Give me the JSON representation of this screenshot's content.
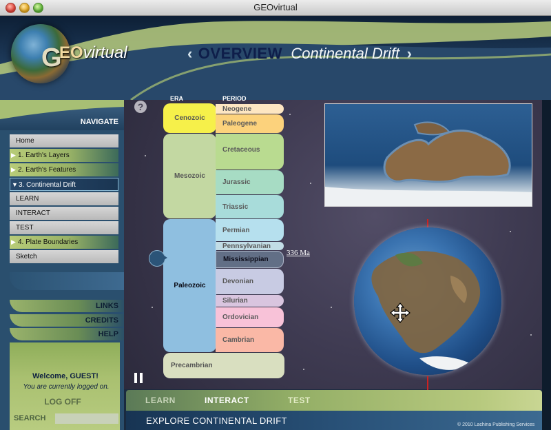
{
  "window": {
    "title": "GEOvirtual"
  },
  "logo": {
    "g": "G",
    "eo": "EO",
    "virtual": "virtual"
  },
  "header": {
    "overview": "OVERVIEW",
    "topic": "Continental Drift",
    "prev": "‹",
    "next": "›"
  },
  "navigate": {
    "label": "NAVIGATE"
  },
  "nav_items": [
    {
      "label": "Home",
      "style": "grey"
    },
    {
      "label": "1. Earth's Layers",
      "style": "green",
      "icon": "triangle-right-icon"
    },
    {
      "label": "2. Earth's Features",
      "style": "green",
      "icon": "triangle-right-icon"
    },
    {
      "label": "3. Continental Drift",
      "style": "active",
      "icon": "triangle-down-icon"
    },
    {
      "label": "LEARN",
      "style": "grey"
    },
    {
      "label": "INTERACT",
      "style": "grey"
    },
    {
      "label": "TEST",
      "style": "grey"
    },
    {
      "label": "4. Plate Boundaries",
      "style": "green",
      "icon": "triangle-right-icon"
    },
    {
      "label": "Sketch",
      "style": "grey"
    }
  ],
  "links": {
    "links": "LINKS",
    "credits": "CREDITS",
    "help": "HELP"
  },
  "user": {
    "welcome": "Welcome, GUEST!",
    "status": "You are currently logged on.",
    "logoff": "LOG OFF"
  },
  "search": {
    "label": "SEARCH",
    "value": "",
    "placeholder": ""
  },
  "timescale": {
    "era_heading": "ERA",
    "period_heading": "PERIOD",
    "eras": [
      {
        "name": "Cenozoic",
        "color": "#f6f04a"
      },
      {
        "name": "Mesozoic",
        "color": "#c3d8a2"
      },
      {
        "name": "Paleozoic",
        "color": "#8fbfe0"
      },
      {
        "name": "Precambrian",
        "color": "#d9dfc0"
      }
    ],
    "periods": [
      {
        "name": "Neogene",
        "color": "#fde6c2"
      },
      {
        "name": "Paleogene",
        "color": "#fcd27c"
      },
      {
        "name": "Cretaceous",
        "color": "#b9db90"
      },
      {
        "name": "Jurassic",
        "color": "#a7dcc4"
      },
      {
        "name": "Triassic",
        "color": "#a8dcda"
      },
      {
        "name": "Permian",
        "color": "#b6e0ee"
      },
      {
        "name": "Pennsylvanian",
        "color": "#c2dde6"
      },
      {
        "name": "Mississippian",
        "color": "#626f86"
      },
      {
        "name": "Devonian",
        "color": "#c8cbe3"
      },
      {
        "name": "Silurian",
        "color": "#d9c5df"
      },
      {
        "name": "Ordovician",
        "color": "#f8c2d8"
      },
      {
        "name": "Cambrian",
        "color": "#fab8a6"
      }
    ],
    "selected_period": "Mississippian",
    "time_label": "336 Ma"
  },
  "modes": {
    "learn": "LEARN",
    "interact": "INTERACT",
    "test": "TEST",
    "active": "INTERACT"
  },
  "footer": {
    "explore": "EXPLORE CONTINENTAL DRIFT",
    "copyright": "© 2010 Lachina Publishing Services"
  },
  "colors": {
    "accent_green": "#9ab36c",
    "navy": "#1e3a5a",
    "active_nav": "#1a3552"
  }
}
